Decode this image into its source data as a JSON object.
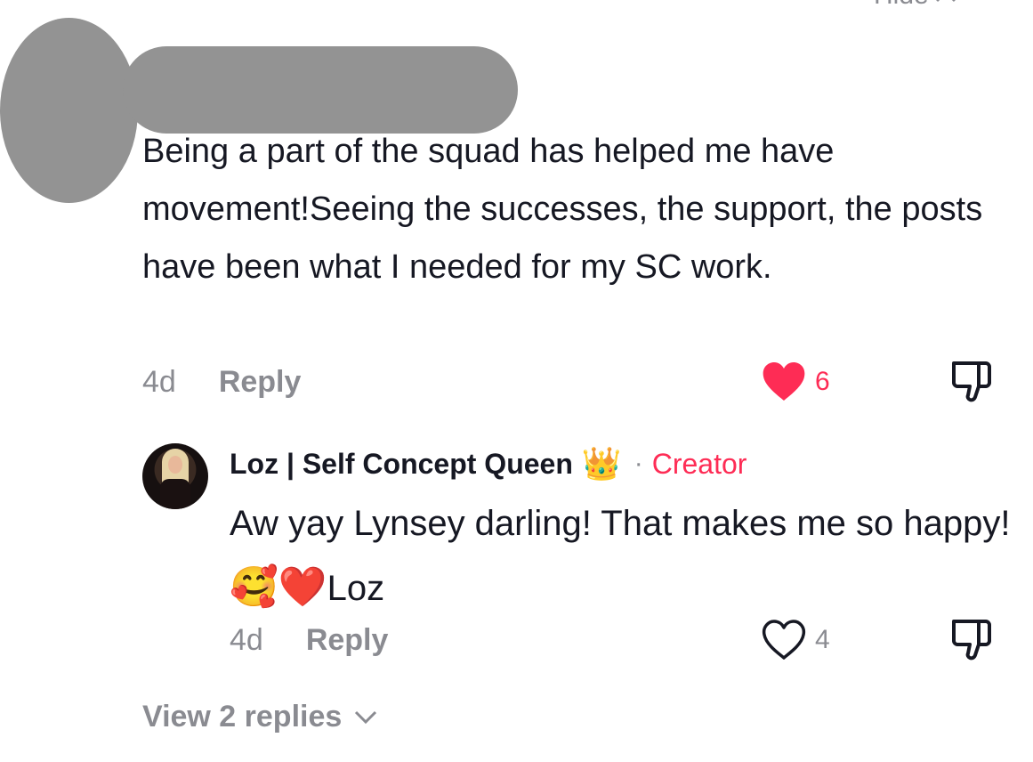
{
  "hide": {
    "label": "Hide"
  },
  "comment": {
    "text": "Being a part of the squad has helped me have movement!Seeing the successes, the support, the posts have been what I needed for my SC work.",
    "age": "4d",
    "reply_label": "Reply",
    "like_count": "6",
    "liked": true
  },
  "reply": {
    "author": "Loz | Self Concept Queen",
    "badge_emoji": "👑",
    "separator": "·",
    "role": "Creator",
    "text_main": "Aw yay Lynsey darling! That makes me so happy! ",
    "emoji_1": "🥰",
    "emoji_2": "❤️",
    "text_signoff": "Loz",
    "age": "4d",
    "reply_label": "Reply",
    "like_count": "4",
    "liked": false
  },
  "view_replies": {
    "label": "View 2 replies"
  },
  "colors": {
    "accent": "#fe2c55",
    "muted": "#8a8b91",
    "text": "#161823",
    "redaction": "#939393"
  }
}
